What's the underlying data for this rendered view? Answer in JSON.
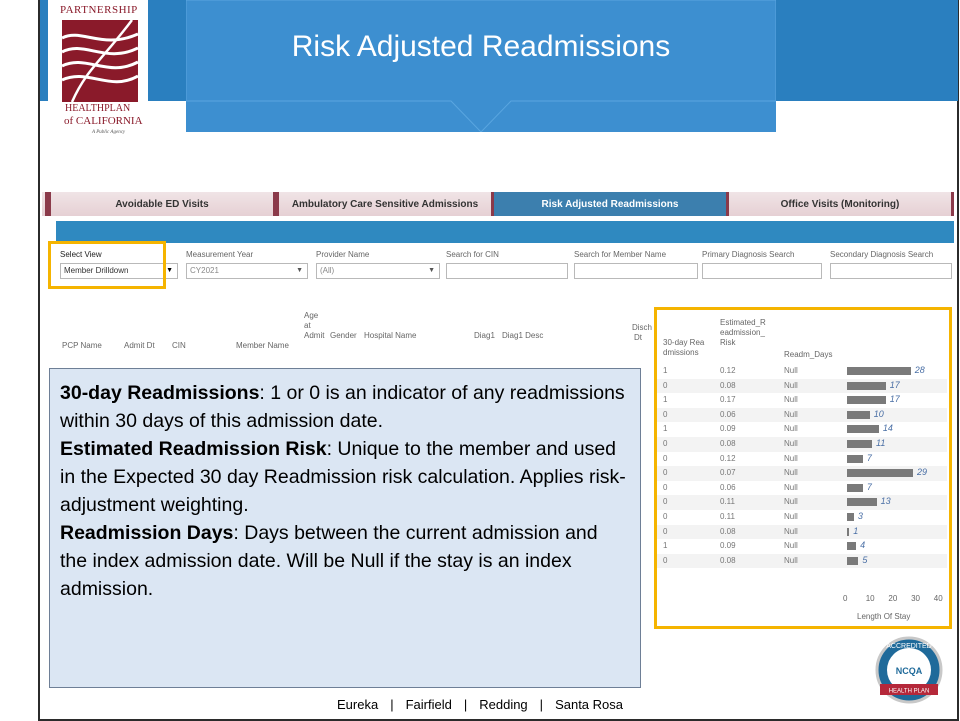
{
  "header": {
    "title": "Risk Adjusted Readmissions",
    "logo": {
      "line1": "PARTNERSHIP",
      "line2": "HEALTHPLAN",
      "line3": "of CALIFORNIA",
      "line4": "A Public Agency"
    }
  },
  "tabs": [
    {
      "label": "Avoidable ED Visits"
    },
    {
      "label": "Ambulatory Care Sensitive Admissions"
    },
    {
      "label": "Risk Adjusted Readmissions"
    },
    {
      "label": "Office Visits (Monitoring)"
    }
  ],
  "filters": {
    "select_view": {
      "label": "Select View",
      "value": "Member Drilldown"
    },
    "measurement_year": {
      "label": "Measurement Year",
      "value": "CY2021"
    },
    "provider_name": {
      "label": "Provider Name",
      "value": "(All)"
    },
    "search_cin": {
      "label": "Search for CIN",
      "value": ""
    },
    "search_member": {
      "label": "Search for Member Name",
      "value": ""
    },
    "primary_diag": {
      "label": "Primary Diagnosis Search",
      "value": ""
    },
    "secondary_diag": {
      "label": "Secondary Diagnosis Search",
      "value": ""
    }
  },
  "table_headers": {
    "pcp_name": "PCP Name",
    "admit_dt": "Admit Dt",
    "cin": "CIN",
    "member_name": "Member Name",
    "age_1": "Age",
    "age_2": "at",
    "age_3": "Admit",
    "gender": "Gender",
    "hospital_name": "Hospital Name",
    "diag1": "Diag1",
    "diag1_desc": "Diag1 Desc",
    "disch_1": "Disch",
    "disch_2": "Dt"
  },
  "right_panel": {
    "col1_line1": "30-day Rea",
    "col1_line2": "dmissions",
    "col2_line1": "Estimated_R",
    "col2_line2": "eadmission_",
    "col2_line3": "Risk",
    "col3": "Readm_Days",
    "rows": [
      {
        "readm": "1",
        "risk": "0.12",
        "days": "Null",
        "los": 28
      },
      {
        "readm": "0",
        "risk": "0.08",
        "days": "Null",
        "los": 17
      },
      {
        "readm": "1",
        "risk": "0.17",
        "days": "Null",
        "los": 17
      },
      {
        "readm": "0",
        "risk": "0.06",
        "days": "Null",
        "los": 10
      },
      {
        "readm": "1",
        "risk": "0.09",
        "days": "Null",
        "los": 14
      },
      {
        "readm": "0",
        "risk": "0.08",
        "days": "Null",
        "los": 11
      },
      {
        "readm": "0",
        "risk": "0.12",
        "days": "Null",
        "los": 7
      },
      {
        "readm": "0",
        "risk": "0.07",
        "days": "Null",
        "los": 29
      },
      {
        "readm": "0",
        "risk": "0.06",
        "days": "Null",
        "los": 7
      },
      {
        "readm": "0",
        "risk": "0.11",
        "days": "Null",
        "los": 13
      },
      {
        "readm": "0",
        "risk": "0.11",
        "days": "Null",
        "los": 3
      },
      {
        "readm": "0",
        "risk": "0.08",
        "days": "Null",
        "los": 1
      },
      {
        "readm": "1",
        "risk": "0.09",
        "days": "Null",
        "los": 4
      },
      {
        "readm": "0",
        "risk": "0.08",
        "days": "Null",
        "los": 5
      }
    ],
    "axis_ticks": [
      "0",
      "10",
      "20",
      "30",
      "40"
    ],
    "axis_title": "Length Of Stay"
  },
  "note": {
    "t1_bold": "30-day Readmissions",
    "t1": ": 1 or 0 is an indicator of any readmissions within 30 days of this admission date.",
    "t2_bold": "Estimated Readmission Risk",
    "t2": ": Unique to the member and used in the Expected 30 day Readmission risk calculation. Applies risk-adjustment weighting.",
    "t3_bold": "Readmission Days",
    "t3": ": Days between the current admission and the index admission date. Will be Null if the stay is an index admission."
  },
  "footer": {
    "items": [
      "Eureka",
      "Fairfield",
      "Redding",
      "Santa Rosa"
    ],
    "separator": "|"
  },
  "badge": {
    "line1": "ACCREDITED",
    "line2": "NCQA",
    "line3": "HEALTH PLAN"
  },
  "colors": {
    "header_blue": "#2a7fbf",
    "highlight": "#f5b400",
    "note_bg": "#dbe6f3",
    "tab_maroon": "#8b3a4a"
  }
}
